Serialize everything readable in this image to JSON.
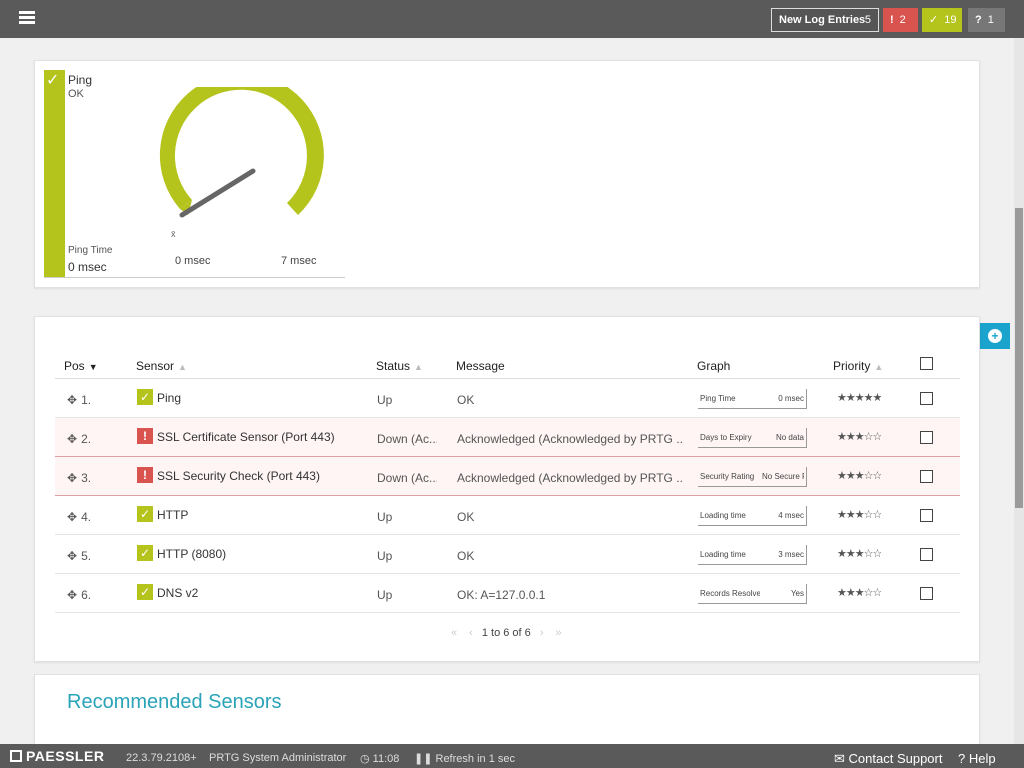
{
  "topbar": {
    "new_log_label": "New Log Entries",
    "new_log_count": "5",
    "error_count": "2",
    "ok_count": "19",
    "unknown_count": "1",
    "colors": {
      "bar": "#5a5a5a",
      "error": "#d9534f",
      "ok": "#b4c41c",
      "unknown": "#777777"
    }
  },
  "gauge": {
    "sensor_name": "Ping",
    "status": "OK",
    "channel_label": "Ping Time",
    "channel_value": "0 msec",
    "min_label": "0 msec",
    "max_label": "7 msec",
    "fill_fraction": 1.0,
    "color": "#b4c41c"
  },
  "table": {
    "headers": {
      "pos": "Pos",
      "sensor": "Sensor",
      "status": "Status",
      "message": "Message",
      "graph": "Graph",
      "priority": "Priority"
    },
    "rows": [
      {
        "pos": "1.",
        "state": "ok",
        "icon": "check-icon",
        "sensor": "Ping",
        "status": "Up",
        "message": "OK",
        "graph_label": "Ping Time",
        "graph_value": "0 msec",
        "priority": "★★★★★"
      },
      {
        "pos": "2.",
        "state": "err",
        "icon": "exclamation-icon",
        "sensor": "SSL Certificate Sensor (Port 443)",
        "status": "Down (Ac...",
        "message": "Acknowledged (Acknowledged by PRTG ...",
        "graph_label": "Days to Expiry",
        "graph_value": "No data",
        "priority": "★★★☆☆"
      },
      {
        "pos": "3.",
        "state": "err",
        "icon": "exclamation-icon",
        "sensor": "SSL Security Check (Port 443)",
        "status": "Down (Ac...",
        "message": "Acknowledged (Acknowledged by PRTG ...",
        "graph_label": "Security Rating",
        "graph_value": "No Secure Prot",
        "priority": "★★★☆☆"
      },
      {
        "pos": "4.",
        "state": "ok",
        "icon": "check-icon",
        "sensor": "HTTP",
        "status": "Up",
        "message": "OK",
        "graph_label": "Loading time",
        "graph_value": "4 msec",
        "priority": "★★★☆☆"
      },
      {
        "pos": "5.",
        "state": "ok",
        "icon": "check-icon",
        "sensor": "HTTP (8080)",
        "status": "Up",
        "message": "OK",
        "graph_label": "Loading time",
        "graph_value": "3 msec",
        "priority": "★★★☆☆"
      },
      {
        "pos": "6.",
        "state": "ok",
        "icon": "check-icon",
        "sensor": "DNS v2",
        "status": "Up",
        "message": "OK: A=127.0.0.1",
        "graph_label": "Records Resolved",
        "graph_value": "Yes",
        "priority": "★★★☆☆"
      }
    ],
    "pager_text": "1 to 6 of 6"
  },
  "recommended": {
    "title": "Recommended Sensors"
  },
  "footer": {
    "brand": "PAESSLER",
    "version": "22.3.79.2108+",
    "user": "PRTG System Administrator",
    "time": "11:08",
    "refresh": "Refresh in 1 sec",
    "contact": "Contact Support",
    "help": "Help"
  }
}
